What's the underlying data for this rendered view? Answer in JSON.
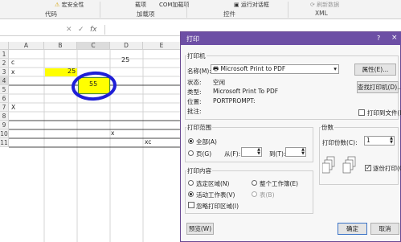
{
  "ribbon": {
    "security_label": "宏安全性",
    "view_code_label": "查看代码",
    "run_dialog_label": "运行对话框",
    "refresh_data_label": "刷新数据",
    "group_code": "代码",
    "group_addins": "加载项",
    "group_controls": "控件",
    "group_xml": "XML",
    "addins_label": "载项",
    "com_addins_label": "COM加载项"
  },
  "formula_bar": {
    "cancel_symbol": "✕",
    "confirm_symbol": "✓",
    "fx_symbol": "fx"
  },
  "sheet": {
    "columns": [
      "A",
      "B",
      "C",
      "D",
      "E"
    ],
    "rows": [
      "1",
      "2",
      "3",
      "4",
      "5",
      "6",
      "7",
      "8",
      "9",
      "10",
      "11"
    ],
    "cells": {
      "A2": "c",
      "E2": "25",
      "A3": "x",
      "B3": "25",
      "C4": "55",
      "A7": "X",
      "D10": "x",
      "E11": "xc"
    },
    "highlight_color": "#ffff00",
    "circle_color": "#1f1fd6"
  },
  "dialog": {
    "title": "打印",
    "help": "?",
    "close": "×",
    "printer_legend": "打印机",
    "name_label": "名称(M):",
    "printer_name": "Microsoft Print to PDF",
    "properties_button": "属性(E)...",
    "status_label": "状态:",
    "status_value": "空闲",
    "type_label": "类型:",
    "type_value": "Microsoft Print To PDF",
    "where_label": "位置:",
    "where_value": "PORTPROMPT:",
    "comment_label": "批注:",
    "find_printer_button": "查找打印机(D)...",
    "print_to_file_label": "打印到文件(L)",
    "range_legend": "打印范围",
    "all_label": "全部(A)",
    "pages_label": "页(G)",
    "from_label": "从(F):",
    "to_label": "到(T):",
    "copies_legend": "份数",
    "copies_label": "打印份数(C):",
    "copies_value": "1",
    "collate_label": "逐份打印(O)",
    "what_legend": "打印内容",
    "selection_label": "选定区域(N)",
    "workbook_label": "整个工作簿(E)",
    "active_sheet_label": "活动工作表(V)",
    "table_label": "表(B)",
    "ignore_area_label": "忽略打印区域(I)",
    "preview_button": "预览(W)",
    "ok_button": "确定",
    "cancel_button": "取消",
    "title_bar_color": "#6d4fa5"
  }
}
